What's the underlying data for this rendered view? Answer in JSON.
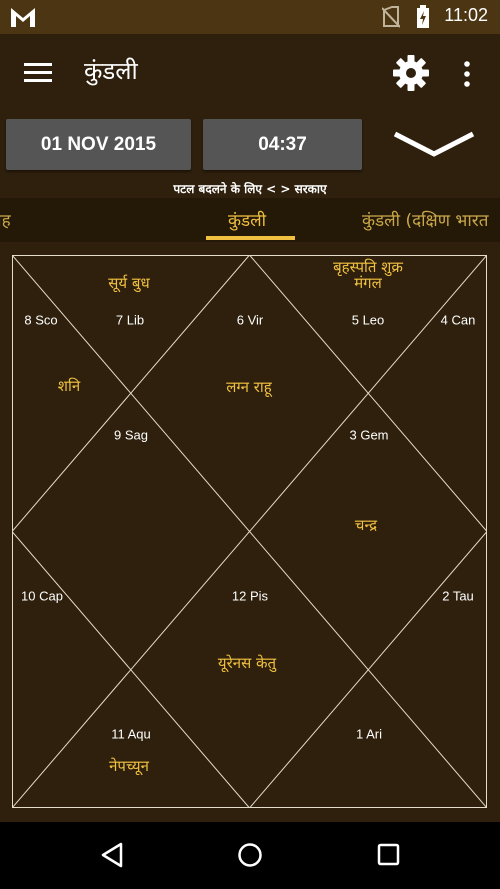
{
  "status_bar": {
    "time": "11:02",
    "icons": [
      "gmail-icon",
      "no-sim-icon",
      "battery-charging-icon"
    ]
  },
  "app_bar": {
    "title": "कुंडली",
    "icons": [
      "menu-icon",
      "gear-icon",
      "overflow-menu-icon"
    ]
  },
  "controls": {
    "date": "01 NOV 2015",
    "time": "04:37",
    "expand_icon": "chevron-down-icon"
  },
  "hint": "पटल बदलने के लिए < > सरकाए",
  "tabs": {
    "left": "ग्रह",
    "active": "कुंडली",
    "right": "कुंडली (दक्षिण भारत"
  },
  "chart": {
    "houses": {
      "h1": {
        "sign": "6 Vir",
        "planets": "लग्न राहू"
      },
      "h2": {
        "sign": "7 Lib",
        "planets": "सूर्य बुध"
      },
      "h3": {
        "sign": "8 Sco",
        "planets": "शनि"
      },
      "h4": {
        "sign": "9 Sag",
        "planets": ""
      },
      "h5": {
        "sign": "10 Cap",
        "planets": ""
      },
      "h6": {
        "sign": "11 Aqu",
        "planets": "नेपच्यून"
      },
      "h7": {
        "sign": "12 Pis",
        "planets": "यूरेनस केतु"
      },
      "h8": {
        "sign": "1 Ari",
        "planets": ""
      },
      "h9": {
        "sign": "2 Tau",
        "planets": ""
      },
      "h10": {
        "sign": "3 Gem",
        "planets": "चन्द्र"
      },
      "h11": {
        "sign": "4 Can",
        "planets": ""
      },
      "h12": {
        "sign": "5 Leo",
        "planets": "बृहस्पति शुक्र मंगल"
      }
    },
    "colors": {
      "line": "#e6dccb",
      "planet_text": "#f0c040",
      "background": "#2e200c"
    }
  },
  "nav_bar": {
    "icons": [
      "back-icon",
      "home-icon",
      "recent-apps-icon"
    ]
  }
}
